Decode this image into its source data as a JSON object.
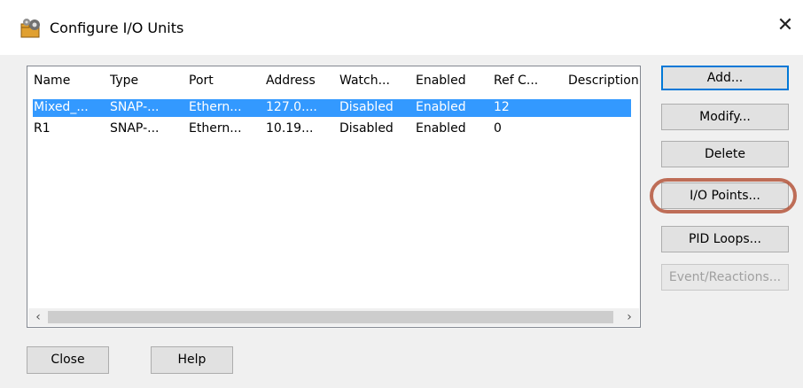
{
  "window": {
    "title": "Configure I/O Units",
    "close_glyph": "✕",
    "icon": "gear-folder-icon"
  },
  "table": {
    "columns": [
      "Name",
      "Type",
      "Port",
      "Address",
      "Watch...",
      "Enabled",
      "Ref C...",
      "Description"
    ],
    "rows": [
      {
        "name": "Mixed_...",
        "type": "SNAP-...",
        "port": "Ethern...",
        "address": "127.0....",
        "watch": "Disabled",
        "enabled": "Enabled",
        "ref": "12",
        "description": "",
        "selected": true
      },
      {
        "name": "R1",
        "type": "SNAP-...",
        "port": "Ethern...",
        "address": "10.19...",
        "watch": "Disabled",
        "enabled": "Enabled",
        "ref": "0",
        "description": "",
        "selected": false
      }
    ],
    "scroll_left": "‹",
    "scroll_right": "›"
  },
  "buttons": {
    "add": "Add...",
    "modify": "Modify...",
    "delete": "Delete",
    "io_points": "I/O Points...",
    "pid_loops": "PID Loops...",
    "event_reactions": "Event/Reactions...",
    "close": "Close",
    "help": "Help"
  },
  "colors": {
    "selection": "#3399ff",
    "highlight_ring": "#b5563c",
    "default_button_border": "#0078d7"
  }
}
